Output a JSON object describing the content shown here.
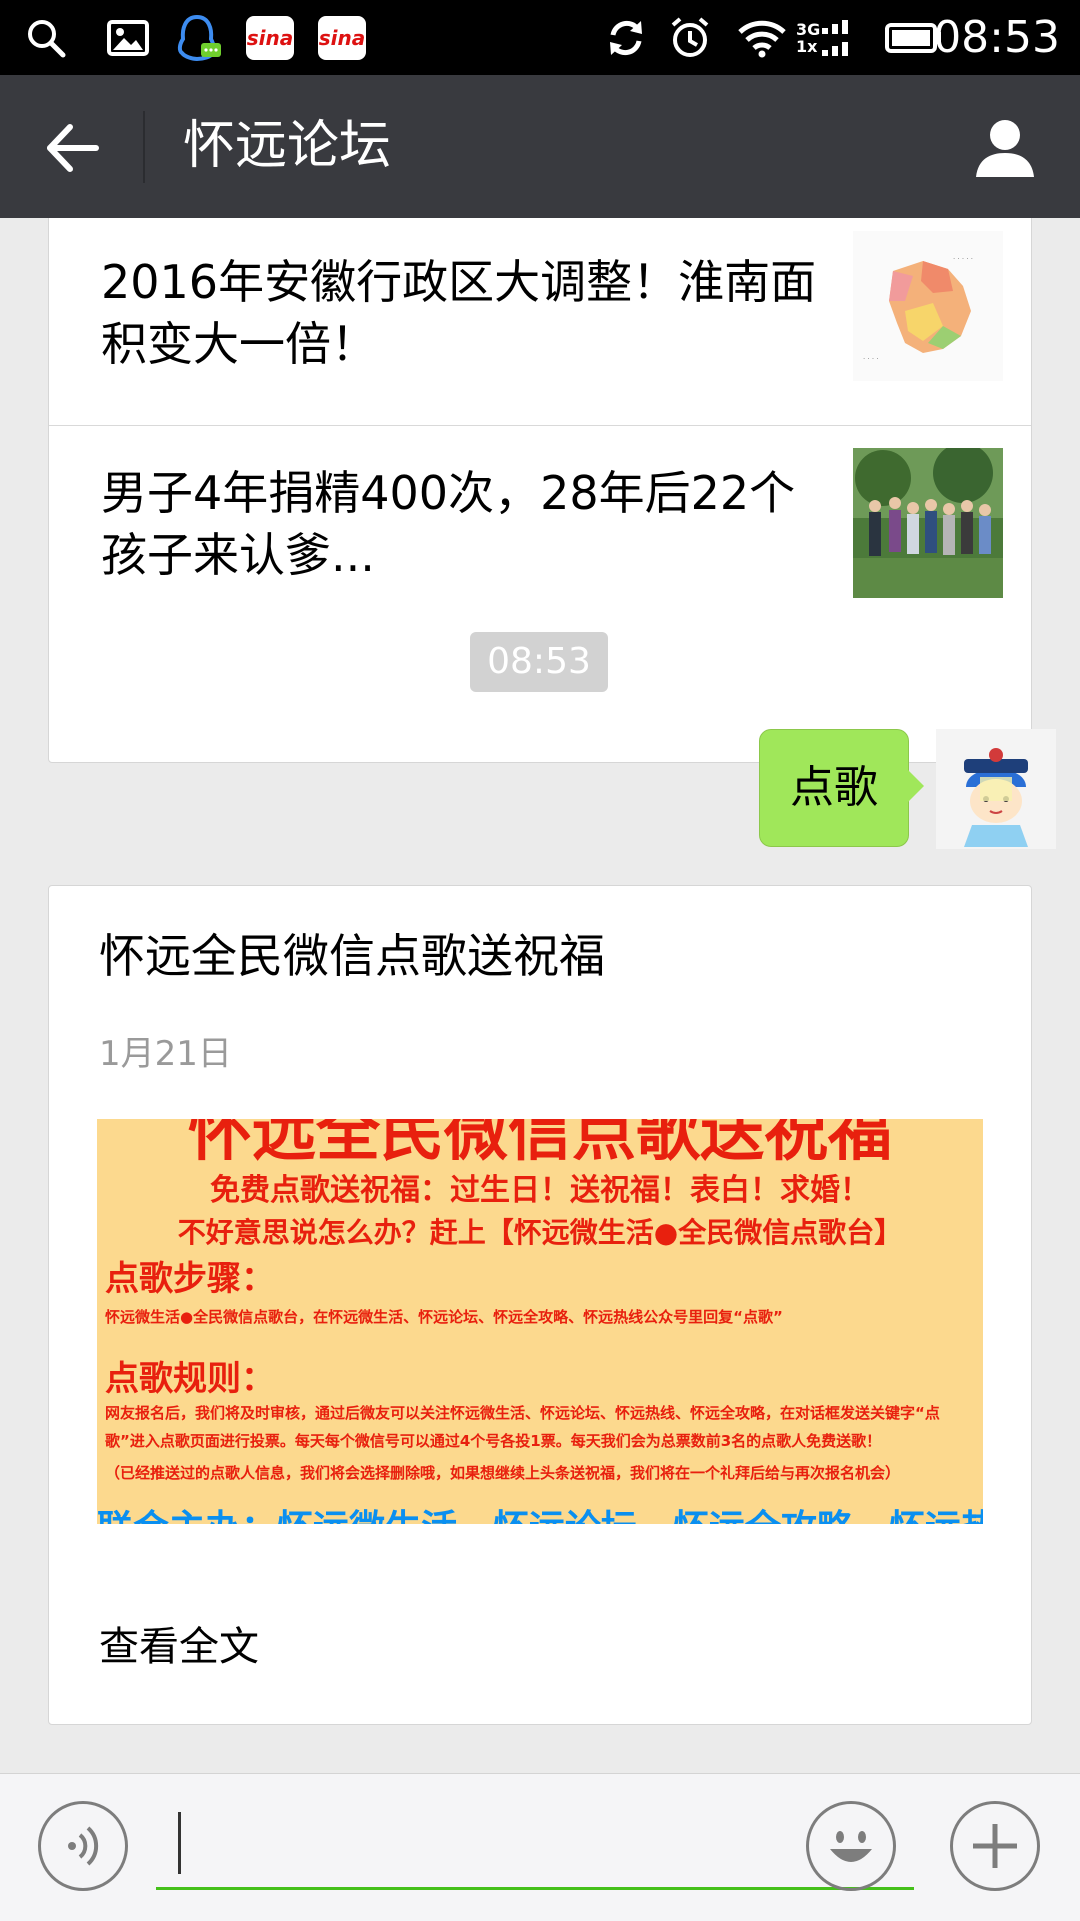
{
  "status_bar": {
    "time": "08:53",
    "left_icons": [
      "search-icon",
      "image-icon",
      "qq-notification-icon",
      "sina-weibo-icon",
      "sina-weibo-icon"
    ],
    "right_icons": [
      "sync-icon",
      "alarm-icon",
      "wifi-icon",
      "signal-icon",
      "battery-icon"
    ],
    "sina_label": "sina",
    "network_top": "3G",
    "network_bottom": "1x"
  },
  "app_bar": {
    "title": "怀远论坛",
    "back_icon": "back-arrow-icon",
    "profile_icon": "person-icon"
  },
  "chat": {
    "news_items": [
      {
        "title": "2016年安徽行政区大调整！淮南面积变大一倍！",
        "thumb": "anhui-map-thumbnail"
      },
      {
        "title": "男子4年捐精400次，28年后22个孩子来认爹...",
        "thumb": "group-photo-thumbnail"
      }
    ],
    "timestamp": "08:53",
    "sent_message": "点歌",
    "article": {
      "title": "怀远全民微信点歌送祝福",
      "date": "1月21日",
      "banner": {
        "heading": "怀远全民微信点歌送祝福",
        "line1": "免费点歌送祝福：过生日！送祝福！表白！求婚！",
        "line2": "不好意思说怎么办？赶上【怀远微生活●全民微信点歌台】",
        "steps_label": "点歌步骤：",
        "steps_text": "怀远微生活●全民微信点歌台，在怀远微生活、怀远论坛、怀远全攻略、怀远热线公众号里回复“点歌”",
        "rules_label": "点歌规则：",
        "rules_text": "网友报名后，我们将及时审核，通过后微友可以关注怀远微生活、怀远论坛、怀远热线、怀远全攻略，在对话框发送关键字“点歌”进入点歌页面进行投票。每天每个微信号可以通过4个号各投1票。每天我们会为总票数前3名的点歌人免费送歌！",
        "rules_note": "（已经推送过的点歌人信息，我们将会选择删除哦，如果想继续上头条送祝福，我们将在一个礼拜后给与再次报名机会）",
        "footer": "联合主办：怀远微生活、怀远论坛、怀远全攻略、怀远热线"
      },
      "read_more": "查看全文"
    }
  },
  "input_bar": {
    "voice_icon": "voice-icon",
    "emoji_icon": "emoji-icon",
    "plus_icon": "plus-icon",
    "value": ""
  },
  "colors": {
    "status_bar": "#000000",
    "app_bar": "#393a3f",
    "chat_bg": "#ebebeb",
    "bubble": "#a0e75a",
    "input_line": "#45c01a",
    "banner_bg": "#fcd98e",
    "banner_text": "#e8200e"
  }
}
